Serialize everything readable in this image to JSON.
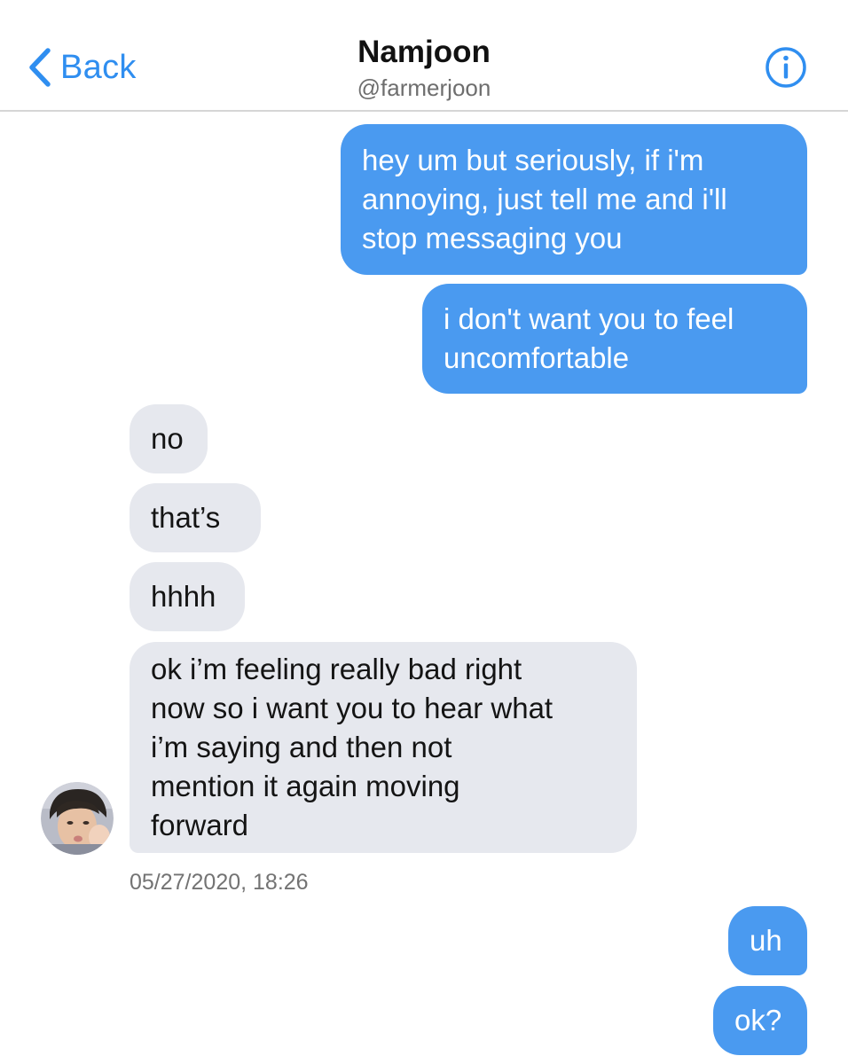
{
  "header": {
    "back_label": "Back",
    "name": "Namjoon",
    "handle": "@farmerjoon"
  },
  "messages": [
    {
      "from": "me",
      "text": "hey um but seriously, if i'm\nannoying, just tell me and i'll\nstop messaging you"
    },
    {
      "from": "me",
      "text": "i don't want you to feel\nuncomfortable"
    },
    {
      "from": "them",
      "text": "no"
    },
    {
      "from": "them",
      "text": "that’s"
    },
    {
      "from": "them",
      "text": "hhhh"
    },
    {
      "from": "them",
      "text": "ok i’m feeling really bad right\nnow so i want you to hear what\ni’m saying and then not\nmention it again moving\nforward"
    },
    {
      "from": "me",
      "text": "uh"
    },
    {
      "from": "me",
      "text": "ok?"
    }
  ],
  "timestamp": "05/27/2020, 18:26",
  "colors": {
    "accent": "#2f8ef0",
    "outgoing_bubble": "#4a9af0",
    "incoming_bubble": "#e6e8ee"
  },
  "icons": {
    "back": "chevron-left-icon",
    "info": "info-icon"
  }
}
